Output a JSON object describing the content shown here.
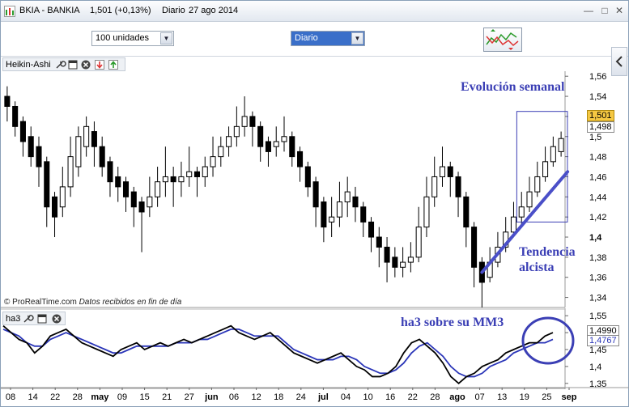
{
  "window": {
    "title_symbol": "BKIA - BANKIA",
    "title_price": "1,501 (+0,13%)",
    "title_period": "Diario",
    "title_date": "27 ago 2014"
  },
  "toolbar": {
    "quantity_select": "100 unidades",
    "period_select": "Diario"
  },
  "price_panel": {
    "name": "Heikin-Ashi",
    "credit_source": "© ProRealTime.com",
    "credit_note": "Datos recibidos en fin de día",
    "y_ticks": [
      "1,56",
      "1,54",
      "1,52",
      "1,5",
      "1,48",
      "1,46",
      "1,44",
      "1,42",
      "1,4",
      "1,38",
      "1,36",
      "1,34"
    ],
    "last_price": "1,501",
    "price_marker": "1,498",
    "annotation_weekly": "Evolución semanal",
    "annotation_trend_1": "Tendencia",
    "annotation_trend_2": "alcista"
  },
  "indicator_panel": {
    "name": "ha3",
    "y_ticks": [
      "1,55",
      "1,5",
      "1,45",
      "1,4",
      "1,35"
    ],
    "value_ha3": "1,4990",
    "value_mm3": "1,4767",
    "annotation": "ha3 sobre su MM3"
  },
  "x_axis": {
    "labels": [
      {
        "text": "08",
        "bold": false
      },
      {
        "text": "14",
        "bold": false
      },
      {
        "text": "22",
        "bold": false
      },
      {
        "text": "28",
        "bold": false
      },
      {
        "text": "may",
        "bold": true
      },
      {
        "text": "09",
        "bold": false
      },
      {
        "text": "15",
        "bold": false
      },
      {
        "text": "21",
        "bold": false
      },
      {
        "text": "27",
        "bold": false
      },
      {
        "text": "jun",
        "bold": true
      },
      {
        "text": "06",
        "bold": false
      },
      {
        "text": "12",
        "bold": false
      },
      {
        "text": "18",
        "bold": false
      },
      {
        "text": "24",
        "bold": false
      },
      {
        "text": "jul",
        "bold": true
      },
      {
        "text": "04",
        "bold": false
      },
      {
        "text": "10",
        "bold": false
      },
      {
        "text": "16",
        "bold": false
      },
      {
        "text": "22",
        "bold": false
      },
      {
        "text": "28",
        "bold": false
      },
      {
        "text": "ago",
        "bold": true
      },
      {
        "text": "07",
        "bold": false
      },
      {
        "text": "13",
        "bold": false
      },
      {
        "text": "19",
        "bold": false
      },
      {
        "text": "25",
        "bold": false
      },
      {
        "text": "sep",
        "bold": true
      }
    ]
  },
  "colors": {
    "annotation": "#3b3fb5",
    "trend_line": "#4a4fc8",
    "mm3_line": "#2a35b8",
    "ha3_line": "#000000",
    "last_price_bg": "#f5c842"
  },
  "chart_data": {
    "type": "candlestick",
    "style": "Heikin-Ashi",
    "ylim": [
      1.33,
      1.565
    ],
    "candles": [
      {
        "o": 1.54,
        "c": 1.53,
        "h": 1.55,
        "l": 1.515
      },
      {
        "o": 1.53,
        "c": 1.51,
        "h": 1.535,
        "l": 1.5
      },
      {
        "o": 1.515,
        "c": 1.495,
        "h": 1.52,
        "l": 1.48
      },
      {
        "o": 1.5,
        "c": 1.48,
        "h": 1.51,
        "l": 1.47
      },
      {
        "o": 1.49,
        "c": 1.47,
        "h": 1.5,
        "l": 1.45
      },
      {
        "o": 1.475,
        "c": 1.43,
        "h": 1.48,
        "l": 1.41
      },
      {
        "o": 1.44,
        "c": 1.42,
        "h": 1.445,
        "l": 1.4
      },
      {
        "o": 1.43,
        "c": 1.45,
        "h": 1.47,
        "l": 1.42
      },
      {
        "o": 1.45,
        "c": 1.48,
        "h": 1.5,
        "l": 1.44
      },
      {
        "o": 1.47,
        "c": 1.5,
        "h": 1.51,
        "l": 1.46
      },
      {
        "o": 1.49,
        "c": 1.51,
        "h": 1.52,
        "l": 1.48
      },
      {
        "o": 1.505,
        "c": 1.49,
        "h": 1.515,
        "l": 1.47
      },
      {
        "o": 1.49,
        "c": 1.47,
        "h": 1.5,
        "l": 1.46
      },
      {
        "o": 1.475,
        "c": 1.455,
        "h": 1.48,
        "l": 1.44
      },
      {
        "o": 1.46,
        "c": 1.45,
        "h": 1.47,
        "l": 1.435
      },
      {
        "o": 1.455,
        "c": 1.44,
        "h": 1.46,
        "l": 1.425
      },
      {
        "o": 1.445,
        "c": 1.43,
        "h": 1.45,
        "l": 1.41
      },
      {
        "o": 1.435,
        "c": 1.425,
        "h": 1.44,
        "l": 1.385
      },
      {
        "o": 1.43,
        "c": 1.44,
        "h": 1.46,
        "l": 1.42
      },
      {
        "o": 1.44,
        "c": 1.455,
        "h": 1.47,
        "l": 1.43
      },
      {
        "o": 1.455,
        "c": 1.46,
        "h": 1.49,
        "l": 1.44
      },
      {
        "o": 1.46,
        "c": 1.455,
        "h": 1.47,
        "l": 1.43
      },
      {
        "o": 1.455,
        "c": 1.46,
        "h": 1.475,
        "l": 1.44
      },
      {
        "o": 1.46,
        "c": 1.465,
        "h": 1.49,
        "l": 1.45
      },
      {
        "o": 1.465,
        "c": 1.46,
        "h": 1.47,
        "l": 1.44
      },
      {
        "o": 1.46,
        "c": 1.47,
        "h": 1.48,
        "l": 1.45
      },
      {
        "o": 1.47,
        "c": 1.48,
        "h": 1.5,
        "l": 1.46
      },
      {
        "o": 1.48,
        "c": 1.49,
        "h": 1.5,
        "l": 1.47
      },
      {
        "o": 1.49,
        "c": 1.5,
        "h": 1.51,
        "l": 1.48
      },
      {
        "o": 1.5,
        "c": 1.51,
        "h": 1.53,
        "l": 1.49
      },
      {
        "o": 1.51,
        "c": 1.52,
        "h": 1.54,
        "l": 1.5
      },
      {
        "o": 1.52,
        "c": 1.51,
        "h": 1.525,
        "l": 1.49
      },
      {
        "o": 1.51,
        "c": 1.49,
        "h": 1.515,
        "l": 1.475
      },
      {
        "o": 1.495,
        "c": 1.485,
        "h": 1.5,
        "l": 1.47
      },
      {
        "o": 1.49,
        "c": 1.495,
        "h": 1.51,
        "l": 1.48
      },
      {
        "o": 1.495,
        "c": 1.5,
        "h": 1.52,
        "l": 1.485
      },
      {
        "o": 1.5,
        "c": 1.48,
        "h": 1.505,
        "l": 1.47
      },
      {
        "o": 1.485,
        "c": 1.47,
        "h": 1.49,
        "l": 1.455
      },
      {
        "o": 1.47,
        "c": 1.45,
        "h": 1.475,
        "l": 1.44
      },
      {
        "o": 1.455,
        "c": 1.43,
        "h": 1.46,
        "l": 1.41
      },
      {
        "o": 1.435,
        "c": 1.41,
        "h": 1.44,
        "l": 1.395
      },
      {
        "o": 1.415,
        "c": 1.42,
        "h": 1.44,
        "l": 1.4
      },
      {
        "o": 1.42,
        "c": 1.435,
        "h": 1.455,
        "l": 1.41
      },
      {
        "o": 1.435,
        "c": 1.445,
        "h": 1.46,
        "l": 1.42
      },
      {
        "o": 1.44,
        "c": 1.43,
        "h": 1.45,
        "l": 1.415
      },
      {
        "o": 1.43,
        "c": 1.415,
        "h": 1.435,
        "l": 1.4
      },
      {
        "o": 1.415,
        "c": 1.4,
        "h": 1.42,
        "l": 1.385
      },
      {
        "o": 1.4,
        "c": 1.39,
        "h": 1.41,
        "l": 1.37
      },
      {
        "o": 1.39,
        "c": 1.375,
        "h": 1.4,
        "l": 1.355
      },
      {
        "o": 1.38,
        "c": 1.37,
        "h": 1.39,
        "l": 1.36
      },
      {
        "o": 1.37,
        "c": 1.375,
        "h": 1.39,
        "l": 1.36
      },
      {
        "o": 1.375,
        "c": 1.38,
        "h": 1.395,
        "l": 1.365
      },
      {
        "o": 1.38,
        "c": 1.41,
        "h": 1.43,
        "l": 1.375
      },
      {
        "o": 1.41,
        "c": 1.44,
        "h": 1.46,
        "l": 1.4
      },
      {
        "o": 1.44,
        "c": 1.46,
        "h": 1.48,
        "l": 1.43
      },
      {
        "o": 1.46,
        "c": 1.47,
        "h": 1.49,
        "l": 1.45
      },
      {
        "o": 1.47,
        "c": 1.46,
        "h": 1.475,
        "l": 1.44
      },
      {
        "o": 1.46,
        "c": 1.44,
        "h": 1.465,
        "l": 1.42
      },
      {
        "o": 1.44,
        "c": 1.41,
        "h": 1.445,
        "l": 1.39
      },
      {
        "o": 1.41,
        "c": 1.37,
        "h": 1.415,
        "l": 1.35
      },
      {
        "o": 1.375,
        "c": 1.355,
        "h": 1.38,
        "l": 1.33
      },
      {
        "o": 1.36,
        "c": 1.375,
        "h": 1.39,
        "l": 1.355
      },
      {
        "o": 1.375,
        "c": 1.39,
        "h": 1.405,
        "l": 1.37
      },
      {
        "o": 1.39,
        "c": 1.405,
        "h": 1.42,
        "l": 1.385
      },
      {
        "o": 1.405,
        "c": 1.42,
        "h": 1.435,
        "l": 1.4
      },
      {
        "o": 1.42,
        "c": 1.43,
        "h": 1.445,
        "l": 1.41
      },
      {
        "o": 1.43,
        "c": 1.445,
        "h": 1.46,
        "l": 1.425
      },
      {
        "o": 1.445,
        "c": 1.46,
        "h": 1.475,
        "l": 1.44
      },
      {
        "o": 1.46,
        "c": 1.475,
        "h": 1.49,
        "l": 1.455
      },
      {
        "o": 1.475,
        "c": 1.49,
        "h": 1.5,
        "l": 1.47
      },
      {
        "o": 1.485,
        "c": 1.498,
        "h": 1.505,
        "l": 1.48
      }
    ],
    "trend_line": {
      "from": {
        "idx": 60,
        "y": 1.365
      },
      "to": {
        "idx": 70,
        "y": 1.465
      }
    },
    "weekly_box": {
      "from_idx": 65,
      "to_idx": 70,
      "ymin": 1.415,
      "ymax": 1.525
    },
    "indicator": {
      "ylim": [
        1.34,
        1.56
      ],
      "ha3": [
        1.52,
        1.5,
        1.48,
        1.47,
        1.44,
        1.46,
        1.49,
        1.5,
        1.51,
        1.49,
        1.47,
        1.46,
        1.45,
        1.44,
        1.43,
        1.45,
        1.46,
        1.47,
        1.45,
        1.46,
        1.47,
        1.46,
        1.47,
        1.48,
        1.47,
        1.48,
        1.49,
        1.5,
        1.51,
        1.52,
        1.5,
        1.49,
        1.48,
        1.49,
        1.5,
        1.48,
        1.46,
        1.44,
        1.43,
        1.42,
        1.41,
        1.42,
        1.43,
        1.44,
        1.42,
        1.4,
        1.39,
        1.37,
        1.37,
        1.38,
        1.4,
        1.44,
        1.47,
        1.48,
        1.46,
        1.44,
        1.41,
        1.37,
        1.35,
        1.37,
        1.38,
        1.4,
        1.41,
        1.42,
        1.44,
        1.45,
        1.46,
        1.47,
        1.47,
        1.49,
        1.5
      ],
      "mm3": [
        1.51,
        1.5,
        1.49,
        1.47,
        1.46,
        1.46,
        1.48,
        1.49,
        1.5,
        1.49,
        1.48,
        1.47,
        1.46,
        1.45,
        1.44,
        1.44,
        1.45,
        1.46,
        1.46,
        1.46,
        1.46,
        1.46,
        1.47,
        1.47,
        1.47,
        1.48,
        1.48,
        1.49,
        1.5,
        1.51,
        1.51,
        1.5,
        1.49,
        1.49,
        1.49,
        1.49,
        1.47,
        1.45,
        1.44,
        1.43,
        1.42,
        1.42,
        1.42,
        1.43,
        1.43,
        1.42,
        1.4,
        1.39,
        1.38,
        1.38,
        1.39,
        1.41,
        1.44,
        1.46,
        1.47,
        1.45,
        1.43,
        1.4,
        1.38,
        1.37,
        1.37,
        1.38,
        1.4,
        1.41,
        1.42,
        1.44,
        1.45,
        1.46,
        1.47,
        1.47,
        1.48
      ]
    }
  }
}
